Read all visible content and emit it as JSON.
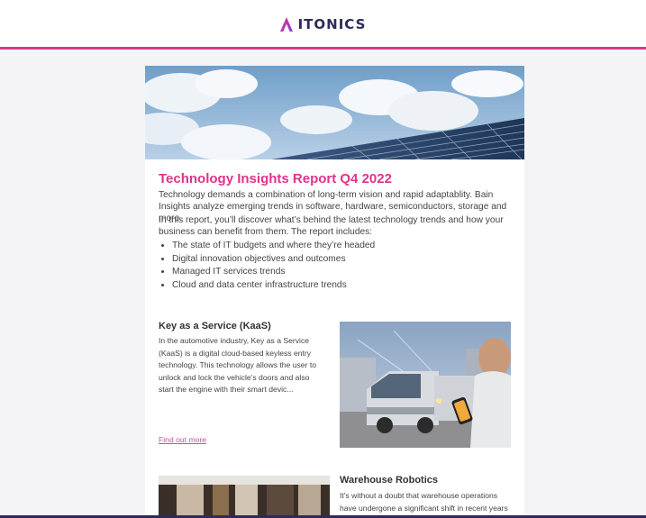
{
  "header": {
    "brand": "ITONICS",
    "colors": {
      "accent": "#e0338b",
      "brand": "#2d2b59"
    }
  },
  "report": {
    "title": "Technology Insights Report Q4 2022",
    "intro1": "Technology demands a combination of long-term vision and rapid adaptablity. Bain Insights analyze emerging trends in software, hardware, semiconductors, storage and more.",
    "intro2": "In this report, you’ll discover what’s behind the latest technology trends and how your business can benefit from them. The report includes:",
    "bullets": [
      "The state of IT budgets and where they’re headed",
      "Digital innovation objectives and outcomes",
      "Managed IT services trends",
      "Cloud and data center infrastructure trends"
    ]
  },
  "section1": {
    "title": "Key as a Service (KaaS)",
    "body": "In the automotive industry, Key as a Service (KaaS) is a digital cloud-based keyless entry technology. This technology allows the user to unlock and lock the vehicle's doors and also start the engine with their smart devic...",
    "link": "Find out more"
  },
  "section2": {
    "title": "Warehouse Robotics",
    "body": "It's without a doubt that warehouse operations have undergone a significant shift in recent years"
  }
}
